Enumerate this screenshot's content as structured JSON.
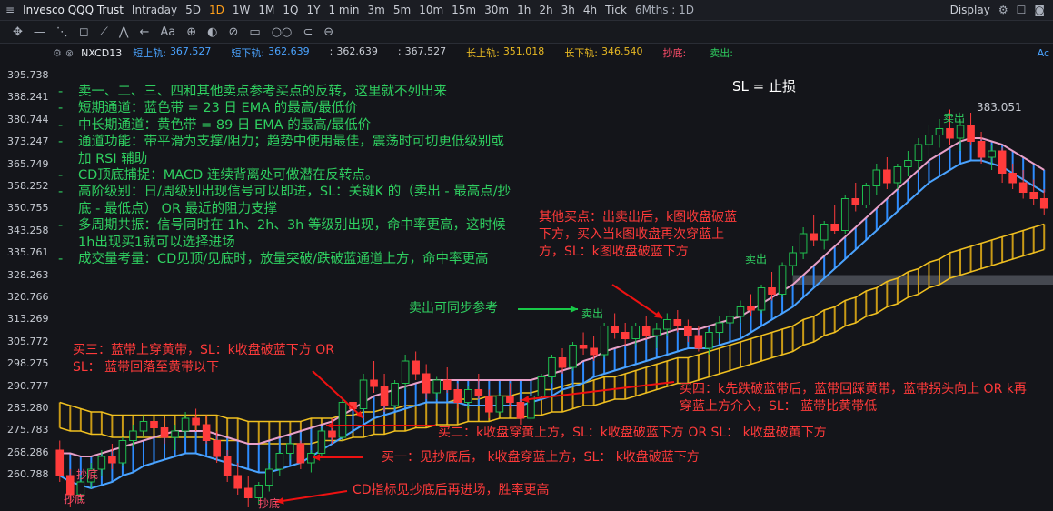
{
  "topbar": {
    "title": "Invesco QQQ Trust",
    "intervals": [
      "Intraday",
      "5D",
      "1D",
      "1W",
      "1M",
      "1Q",
      "1Y",
      "1 min",
      "3m",
      "5m",
      "10m",
      "15m",
      "30m",
      "1h",
      "2h",
      "3h",
      "4h",
      "Tick"
    ],
    "active_interval": "1D",
    "range": "6Mths : 1D",
    "display": "Display"
  },
  "toolbar": {
    "tools": [
      "✥",
      "—",
      "⋱",
      "◻",
      "⟋",
      "⋀",
      "←",
      "Aa",
      "⊕",
      "◐",
      "⊘",
      "▭",
      "○○",
      "⊂",
      "⊖"
    ]
  },
  "legend": {
    "symbol": "NXCD13",
    "items": [
      {
        "label": "短上轨:",
        "value": "367.527",
        "color": "#4aa3ff"
      },
      {
        "label": "短下轨:",
        "value": "362.639",
        "color": "#4aa3ff"
      },
      {
        "label": ":",
        "value": "362.639",
        "color": "#c8ccd4"
      },
      {
        "label": ":",
        "value": "367.527",
        "color": "#c8ccd4"
      },
      {
        "label": "长上轨:",
        "value": "351.018",
        "color": "#e8b923"
      },
      {
        "label": "长下轨:",
        "value": "346.540",
        "color": "#e8b923"
      },
      {
        "label": "抄底:",
        "value": "",
        "color": "#ff4d6a"
      },
      {
        "label": "卖出:",
        "value": "",
        "color": "#2fcf60"
      }
    ],
    "tail": "Ac"
  },
  "y_axis": [
    "395.738",
    "388.241",
    "380.744",
    "373.247",
    "365.749",
    "358.252",
    "350.755",
    "343.258",
    "335.761",
    "328.263",
    "320.766",
    "313.269",
    "305.772",
    "298.275",
    "290.777",
    "283.280",
    "275.783",
    "268.286",
    "260.788"
  ],
  "notes": [
    "卖一、二、三、四和其他卖点参考买点的反转，这里就不列出来",
    "短期通道：蓝色带 = 23 日 EMA 的最高/最低价",
    "中长期通道：黄色带 = 89 日 EMA 的最高/最低价",
    "通道功能：带平滑为支撑/阻力；趋势中使用最佳，震荡时可切更低级别或加 RSI 辅助",
    "CD顶底捕捉：MACD 连续背离处可做潜在反转点。",
    "高阶级别：日/周级别出现信号可以即进，SL：关键K 的（卖出 - 最高点/抄底 - 最低点） OR  最近的阻力支撑",
    "多周期共振：信号同时在 1h、2h、3h 等级别出现，命中率更高，这时候1h出现买1就可以选择进场",
    "成交量考量：CD见顶/见底时，放量突破/跌破蓝通道上方，命中率更高"
  ],
  "annotations": {
    "sl": "SL = 止损",
    "other_buy": "其他买点：出卖出后，k图收盘破蓝下方，买入当k图收盘再次穿蓝上方，SL：k图收盘破蓝下方",
    "sell_sync": "卖出可同步参考",
    "buy3": "买三：蓝带上穿黄带，SL：k收盘破蓝下方   OR  SL：  蓝带回落至黄带以下",
    "buy4": "买四：k先跌破蓝带后，蓝带回踩黄带，蓝带拐头向上 OR  k再穿蓝上方介入，SL：  蓝带比黄带低",
    "buy2": "买二：k收盘穿黄上方，SL：k收盘破蓝下方   OR  SL：  k收盘破黄下方",
    "buy1": "买一：见抄底后，  k收盘穿蓝上方，SL：  k收盘破蓝下方",
    "cd": "CD指标见抄底后再进场，胜率更高"
  },
  "chart_labels": {
    "high": "383.051",
    "sell1": "卖出",
    "sell2": "卖出",
    "sell3": "卖出",
    "bottom1": "抄底",
    "bottom2": "抄底",
    "bottom3": "抄底"
  },
  "chart_data": {
    "type": "candlestick",
    "ylim": [
      258,
      398
    ],
    "ohlc": [
      [
        276,
        279,
        266,
        268
      ],
      [
        268,
        270,
        258,
        262
      ],
      [
        262,
        268,
        260,
        266
      ],
      [
        266,
        272,
        264,
        270
      ],
      [
        270,
        276,
        268,
        274
      ],
      [
        274,
        278,
        270,
        272
      ],
      [
        272,
        280,
        271,
        279
      ],
      [
        279,
        284,
        277,
        282
      ],
      [
        282,
        287,
        280,
        285
      ],
      [
        285,
        289,
        281,
        283
      ],
      [
        283,
        286,
        278,
        280
      ],
      [
        280,
        284,
        276,
        282
      ],
      [
        282,
        288,
        280,
        286
      ],
      [
        286,
        289,
        282,
        284
      ],
      [
        284,
        287,
        278,
        279
      ],
      [
        279,
        282,
        272,
        274
      ],
      [
        274,
        276,
        266,
        268
      ],
      [
        268,
        272,
        262,
        264
      ],
      [
        264,
        268,
        258,
        261
      ],
      [
        261,
        266,
        259,
        265
      ],
      [
        265,
        272,
        263,
        270
      ],
      [
        270,
        276,
        268,
        275
      ],
      [
        275,
        280,
        273,
        278
      ],
      [
        278,
        279,
        270,
        272
      ],
      [
        272,
        276,
        269,
        275
      ],
      [
        275,
        283,
        274,
        282
      ],
      [
        282,
        286,
        278,
        280
      ],
      [
        280,
        292,
        279,
        291
      ],
      [
        291,
        296,
        287,
        289
      ],
      [
        289,
        300,
        288,
        298
      ],
      [
        298,
        304,
        294,
        296
      ],
      [
        296,
        300,
        288,
        290
      ],
      [
        290,
        298,
        289,
        297
      ],
      [
        297,
        306,
        295,
        304
      ],
      [
        304,
        307,
        298,
        300
      ],
      [
        300,
        303,
        292,
        294
      ],
      [
        294,
        299,
        292,
        298
      ],
      [
        298,
        302,
        294,
        295
      ],
      [
        295,
        297,
        289,
        291
      ],
      [
        291,
        296,
        289,
        295
      ],
      [
        295,
        300,
        292,
        293
      ],
      [
        293,
        295,
        286,
        288
      ],
      [
        288,
        294,
        287,
        293
      ],
      [
        293,
        297,
        289,
        291
      ],
      [
        291,
        292,
        284,
        286
      ],
      [
        286,
        294,
        285,
        293
      ],
      [
        293,
        300,
        292,
        299
      ],
      [
        299,
        306,
        297,
        305
      ],
      [
        305,
        308,
        300,
        302
      ],
      [
        302,
        310,
        301,
        309
      ],
      [
        309,
        313,
        306,
        308
      ],
      [
        308,
        312,
        304,
        306
      ],
      [
        306,
        316,
        305,
        315
      ],
      [
        315,
        319,
        311,
        313
      ],
      [
        313,
        316,
        309,
        311
      ],
      [
        311,
        316,
        309,
        315
      ],
      [
        315,
        318,
        311,
        312
      ],
      [
        312,
        316,
        308,
        314
      ],
      [
        314,
        319,
        312,
        317
      ],
      [
        317,
        320,
        313,
        315
      ],
      [
        315,
        317,
        310,
        312
      ],
      [
        312,
        315,
        307,
        308
      ],
      [
        308,
        314,
        306,
        313
      ],
      [
        313,
        318,
        311,
        316
      ],
      [
        316,
        320,
        313,
        318
      ],
      [
        318,
        323,
        316,
        321
      ],
      [
        321,
        325,
        318,
        320
      ],
      [
        320,
        328,
        319,
        327
      ],
      [
        327,
        332,
        323,
        325
      ],
      [
        325,
        335,
        324,
        334
      ],
      [
        334,
        340,
        331,
        338
      ],
      [
        338,
        346,
        336,
        344
      ],
      [
        344,
        350,
        340,
        342
      ],
      [
        342,
        348,
        339,
        347
      ],
      [
        347,
        353,
        344,
        345
      ],
      [
        345,
        356,
        344,
        355
      ],
      [
        355,
        360,
        351,
        353
      ],
      [
        353,
        360,
        352,
        359
      ],
      [
        359,
        366,
        356,
        364
      ],
      [
        364,
        368,
        358,
        360
      ],
      [
        360,
        366,
        358,
        365
      ],
      [
        365,
        370,
        362,
        367
      ],
      [
        367,
        374,
        364,
        372
      ],
      [
        372,
        378,
        368,
        375
      ],
      [
        375,
        380,
        371,
        377
      ],
      [
        377,
        383,
        372,
        374
      ],
      [
        374,
        380,
        370,
        378
      ],
      [
        378,
        382,
        372,
        373
      ],
      [
        373,
        376,
        366,
        368
      ],
      [
        368,
        372,
        364,
        370
      ],
      [
        370,
        371,
        360,
        363
      ],
      [
        363,
        366,
        358,
        360
      ],
      [
        360,
        364,
        355,
        357
      ],
      [
        357,
        361,
        353,
        355
      ],
      [
        355,
        358,
        350,
        352
      ]
    ],
    "blue_upper": [
      275,
      275,
      274,
      274,
      275,
      276,
      277,
      278,
      279,
      280,
      281,
      282,
      282,
      282,
      282,
      281,
      280,
      279,
      278,
      278,
      279,
      280,
      281,
      282,
      283,
      284,
      285,
      287,
      289,
      291,
      293,
      294,
      295,
      296,
      297,
      298,
      298,
      298,
      298,
      298,
      298,
      298,
      298,
      298,
      298,
      298,
      299,
      300,
      301,
      302,
      304,
      305,
      307,
      308,
      309,
      310,
      311,
      312,
      313,
      314,
      314,
      314,
      315,
      316,
      317,
      318,
      320,
      322,
      324,
      326,
      328,
      331,
      334,
      337,
      340,
      343,
      346,
      349,
      352,
      355,
      358,
      361,
      364,
      367,
      369,
      371,
      373,
      374,
      374,
      373,
      372,
      370,
      368,
      366,
      364
    ],
    "blue_lower": [
      268,
      266,
      265,
      264,
      265,
      266,
      268,
      269,
      271,
      272,
      273,
      274,
      275,
      275,
      274,
      273,
      272,
      271,
      270,
      269,
      269,
      270,
      271,
      272,
      274,
      276,
      278,
      280,
      282,
      284,
      286,
      287,
      288,
      289,
      290,
      291,
      291,
      291,
      291,
      290,
      290,
      290,
      290,
      290,
      290,
      291,
      292,
      293,
      295,
      296,
      297,
      299,
      300,
      301,
      302,
      303,
      304,
      305,
      306,
      307,
      308,
      308,
      308,
      309,
      310,
      311,
      313,
      315,
      317,
      319,
      321,
      324,
      327,
      330,
      333,
      336,
      339,
      342,
      345,
      348,
      351,
      354,
      357,
      360,
      362,
      364,
      366,
      367,
      367,
      366,
      365,
      363,
      361,
      359,
      357
    ],
    "yellow_upper": [
      291,
      290,
      289,
      288,
      288,
      287,
      287,
      287,
      287,
      287,
      287,
      287,
      287,
      287,
      287,
      287,
      286,
      286,
      285,
      285,
      285,
      285,
      285,
      285,
      286,
      286,
      286,
      287,
      287,
      288,
      288,
      289,
      289,
      290,
      290,
      291,
      291,
      291,
      292,
      292,
      292,
      293,
      293,
      293,
      294,
      294,
      295,
      295,
      296,
      297,
      297,
      298,
      299,
      299,
      300,
      301,
      302,
      303,
      304,
      305,
      305,
      306,
      307,
      308,
      309,
      310,
      311,
      312,
      313,
      314,
      315,
      317,
      318,
      320,
      321,
      323,
      324,
      326,
      327,
      329,
      330,
      332,
      333,
      335,
      336,
      338,
      339,
      340,
      341,
      342,
      343,
      344,
      345,
      346,
      347
    ],
    "yellow_lower": [
      283,
      282,
      282,
      281,
      281,
      280,
      280,
      280,
      280,
      280,
      280,
      280,
      280,
      280,
      280,
      279,
      279,
      279,
      278,
      278,
      278,
      278,
      278,
      278,
      278,
      279,
      279,
      279,
      280,
      280,
      281,
      281,
      282,
      282,
      283,
      283,
      284,
      284,
      284,
      285,
      285,
      285,
      286,
      286,
      286,
      287,
      287,
      288,
      288,
      289,
      290,
      290,
      291,
      292,
      292,
      293,
      294,
      295,
      296,
      297,
      297,
      298,
      299,
      300,
      301,
      302,
      303,
      304,
      305,
      306,
      307,
      309,
      310,
      312,
      313,
      315,
      316,
      318,
      319,
      321,
      322,
      324,
      325,
      327,
      328,
      330,
      331,
      332,
      333,
      334,
      335,
      336,
      337,
      338,
      339
    ]
  }
}
